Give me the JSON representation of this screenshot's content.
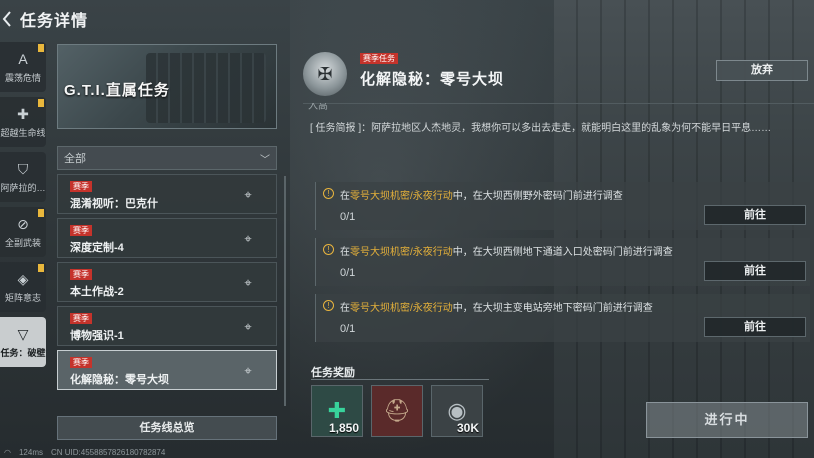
{
  "header": {
    "title": "任务详情"
  },
  "rail": [
    {
      "label": "震荡危情",
      "icon": "a-icon",
      "badge": true,
      "active": false
    },
    {
      "label": "超越生命线",
      "icon": "plus-icon",
      "badge": true,
      "active": false
    },
    {
      "label": "阿萨拉的…",
      "icon": "shield-icon",
      "badge": false,
      "active": false
    },
    {
      "label": "全副武装",
      "icon": "slash-circle-icon",
      "badge": true,
      "active": false
    },
    {
      "label": "矩阵意志",
      "icon": "diamond-icon",
      "badge": true,
      "active": false
    },
    {
      "label": "任务：破壁",
      "icon": "triangle-down-icon",
      "badge": false,
      "active": true
    }
  ],
  "banner": {
    "title": "G.T.I.直属任务"
  },
  "filter": {
    "value": "全部"
  },
  "missions": [
    {
      "tag": "赛季",
      "name": "混淆视听：巴克什"
    },
    {
      "tag": "赛季",
      "name": "深度定制-4"
    },
    {
      "tag": "赛季",
      "name": "本土作战-2"
    },
    {
      "tag": "赛季",
      "name": "博物强识-1"
    },
    {
      "tag": "赛季",
      "name": "化解隐秘：零号大坝"
    }
  ],
  "overview_label": "任务线总览",
  "footer": {
    "ping": "124ms",
    "uid": "CN UID:4558857826180782874"
  },
  "detail": {
    "tag": "赛季任务",
    "title": "化解隐秘：零号大坝",
    "abandon_label": "放弃",
    "cut_text": "入高",
    "brief_prefix": "[ 任务简报 ]：",
    "brief_text": "阿萨拉地区人杰地灵，我想你可以多出去走走，就能明白这里的乱象为何不能早日平息……",
    "objectives": [
      {
        "pre": "在",
        "hl": "零号大坝机密/永夜行动",
        "post": "中，在大坝西侧野外密码门前进行调查",
        "progress": "0/1",
        "button": "前往"
      },
      {
        "pre": "在",
        "hl": "零号大坝机密/永夜行动",
        "post": "中，在大坝西侧地下通道入口处密码门前进行调查",
        "progress": "0/1",
        "button": "前往"
      },
      {
        "pre": "在",
        "hl": "零号大坝机密/永夜行动",
        "post": "中，在大坝主变电站旁地下密码门前进行调查",
        "progress": "0/1",
        "button": "前往"
      }
    ],
    "rewards_label": "任务奖励",
    "rewards": [
      {
        "icon": "token-icon",
        "qty": "1,850"
      },
      {
        "icon": "helmet-icon",
        "qty": ""
      },
      {
        "icon": "coin-icon",
        "qty": "30K"
      }
    ],
    "status_button": "进行中"
  },
  "colors": {
    "season_tag": "#c5332b",
    "highlight": "#e5b13a",
    "badge": "#e9b73c"
  }
}
